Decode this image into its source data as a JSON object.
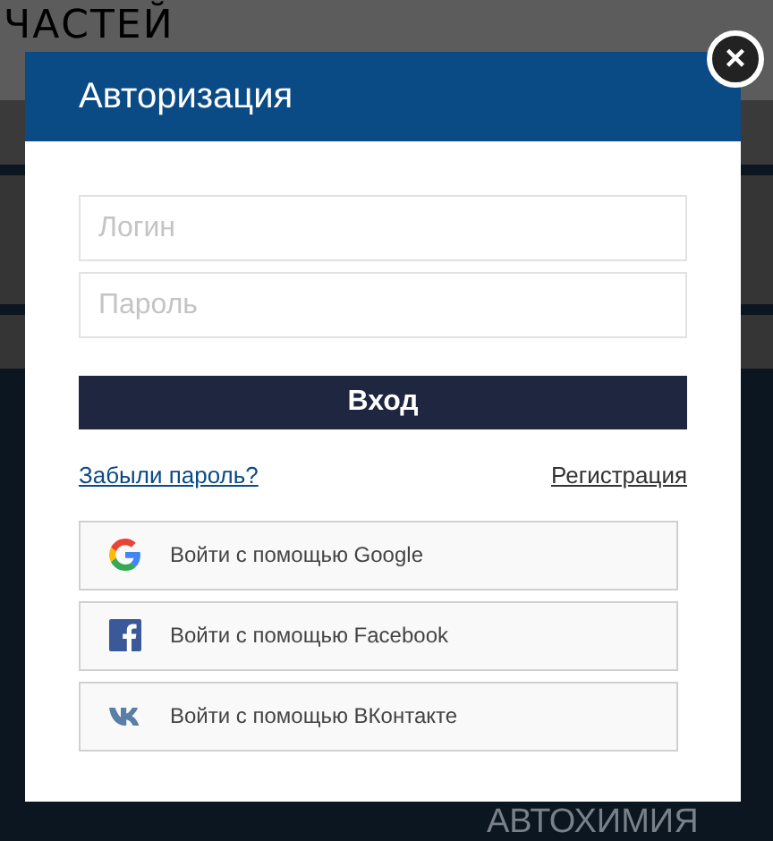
{
  "background": {
    "heading_lines": [
      "ЧАСТЕЙ"
    ],
    "tile_label": "АВТОХИМИЯ"
  },
  "modal": {
    "title": "Авторизация",
    "close_label": "×",
    "fields": [
      {
        "placeholder": "Логин"
      },
      {
        "placeholder": "Пароль"
      }
    ],
    "submit": "Вход",
    "forgot_link": "Забыли пароль?",
    "register_link": "Регистрация",
    "social": [
      {
        "kind": "google",
        "label": "Войти с помощью Google"
      },
      {
        "kind": "facebook",
        "label": "Войти с помощью Facebook"
      },
      {
        "kind": "vk",
        "label": "Войти с помощью ВКонтакте"
      }
    ]
  }
}
